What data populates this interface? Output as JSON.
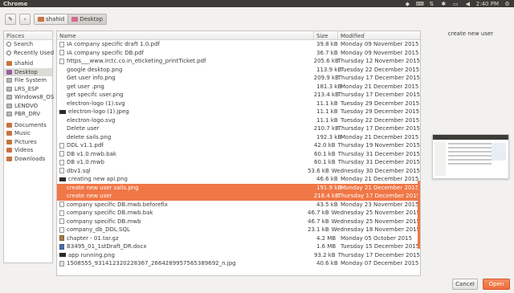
{
  "topbar": {
    "title": "Chrome",
    "time": "2:40 PM",
    "tray_icons": [
      "dropbox-icon",
      "keyboard-icon",
      "network-icon",
      "bluetooth-icon",
      "battery-icon",
      "volume-icon",
      "clock",
      "settings-icon"
    ]
  },
  "toolbar": {
    "edit_glyph": "✎",
    "back_glyph": "‹",
    "crumbs": [
      {
        "label": "shahid",
        "active": false
      },
      {
        "label": "Desktop",
        "active": true
      }
    ]
  },
  "places": {
    "header": "Places",
    "items": [
      {
        "label": "Search",
        "icon": "search-icon",
        "active": false
      },
      {
        "label": "Recently Used",
        "icon": "recent-icon",
        "active": false
      },
      {
        "label": "shahid",
        "icon": "home-folder-icon",
        "active": false
      },
      {
        "label": "Desktop",
        "icon": "desktop-folder-icon",
        "active": true
      },
      {
        "label": "File System",
        "icon": "drive-icon",
        "active": false
      },
      {
        "label": "LRS_ESP",
        "icon": "drive-icon",
        "active": false
      },
      {
        "label": "Windows8_OS",
        "icon": "drive-icon",
        "active": false
      },
      {
        "label": "LENOVO",
        "icon": "drive-icon",
        "active": false
      },
      {
        "label": "PBR_DRV",
        "icon": "drive-icon",
        "active": false
      },
      {
        "label": "Documents",
        "icon": "documents-folder-icon",
        "active": false
      },
      {
        "label": "Music",
        "icon": "music-folder-icon",
        "active": false
      },
      {
        "label": "Pictures",
        "icon": "pictures-folder-icon",
        "active": false
      },
      {
        "label": "Videos",
        "icon": "videos-folder-icon",
        "active": false
      },
      {
        "label": "Downloads",
        "icon": "downloads-folder-icon",
        "active": false
      }
    ]
  },
  "files": {
    "columns": {
      "name": "Name",
      "size": "Size",
      "modified": "Modified"
    },
    "rows": [
      {
        "name": "IA company specific draft 1.0.pdf",
        "size": "39.8 kB",
        "modified": "Monday 09 November 2015",
        "icon": "file",
        "selected": false
      },
      {
        "name": "IA company specific DB.pdf",
        "size": "36.7 kB",
        "modified": "Monday 09 November 2015",
        "icon": "file",
        "selected": false
      },
      {
        "name": "https___www.irctc.co.in_eticketing_printTicket.pdf",
        "size": "205.6 kB",
        "modified": "Thursday 12 November 2015",
        "icon": "file",
        "selected": false
      },
      {
        "name": "google desktop.png",
        "size": "113.9 kB",
        "modified": "Tuesday 22 December 2015",
        "icon": "none",
        "selected": false
      },
      {
        "name": "Get user info.png",
        "size": "209.9 kB",
        "modified": "Thursday 17 December 2015",
        "icon": "none",
        "selected": false
      },
      {
        "name": "get user .png",
        "size": "181.3 kB",
        "modified": "Monday 21 December 2015",
        "icon": "none",
        "selected": false
      },
      {
        "name": "get specifc user.png",
        "size": "213.4 kB",
        "modified": "Thursday 17 December 2015",
        "icon": "none",
        "selected": false
      },
      {
        "name": "electron-logo (1).svg",
        "size": "11.1 kB",
        "modified": "Tuesday 29 December 2015",
        "icon": "none",
        "selected": false
      },
      {
        "name": "electron-logo (1).jpeg",
        "size": "11.1 kB",
        "modified": "Tuesday 29 December 2015",
        "icon": "dark",
        "selected": false
      },
      {
        "name": "electron-logo.svg",
        "size": "11.1 kB",
        "modified": "Tuesday 22 December 2015",
        "icon": "none",
        "selected": false
      },
      {
        "name": "Delete user",
        "size": "210.7 kB",
        "modified": "Thursday 17 December 2015",
        "icon": "none",
        "selected": false
      },
      {
        "name": "delete sails.png",
        "size": "192.3 kB",
        "modified": "Monday 21 December 2015",
        "icon": "none",
        "selected": false
      },
      {
        "name": "DDL v1.1.pdf",
        "size": "42.0 kB",
        "modified": "Thursday 19 November 2015",
        "icon": "file",
        "selected": false
      },
      {
        "name": "DB v1.0.mwb.bak",
        "size": "60.1 kB",
        "modified": "Thursday 31 December 2015",
        "icon": "file",
        "selected": false
      },
      {
        "name": "DB v1.0.mwb",
        "size": "60.1 kB",
        "modified": "Thursday 31 December 2015",
        "icon": "file",
        "selected": false
      },
      {
        "name": "dbv1.sql",
        "size": "53.6 kB",
        "modified": "Wednesday 30 December 2015",
        "icon": "file",
        "selected": false
      },
      {
        "name": "creating new api.png",
        "size": "46.6 kB",
        "modified": "Monday 21 December 2015",
        "icon": "dark",
        "selected": false
      },
      {
        "name": "create new user sails.png",
        "size": "191.9 kB",
        "modified": "Monday 21 December 2015",
        "icon": "none",
        "selected": true
      },
      {
        "name": "create new user",
        "size": "216.4 kB",
        "modified": "Thursday 17 December 2015",
        "icon": "none",
        "selected": true
      },
      {
        "name": "company specific DB.mwb.beforefix",
        "size": "43.5 kB",
        "modified": "Monday 23 November 2015",
        "icon": "file",
        "selected": false
      },
      {
        "name": "company specific DB.mwb.bak",
        "size": "46.7 kB",
        "modified": "Wednesday 25 November 2015",
        "icon": "file",
        "selected": false
      },
      {
        "name": "company specific DB.mwb",
        "size": "46.7 kB",
        "modified": "Wednesday 25 November 2015",
        "icon": "file",
        "selected": false
      },
      {
        "name": "company_db_DDL.SQL",
        "size": "23.1 kB",
        "modified": "Wednesday 18 November 2015",
        "icon": "file",
        "selected": false
      },
      {
        "name": "chapter - 01.tar.gz",
        "size": "4.2 MB",
        "modified": "Monday 05 October 2015",
        "icon": "arch",
        "selected": false
      },
      {
        "name": "B3495_01_1stDraft_DR.docx",
        "size": "1.6 MB",
        "modified": "Tuesday 15 December 2015",
        "icon": "doc",
        "selected": false
      },
      {
        "name": "app running.png",
        "size": "93.2 kB",
        "modified": "Thursday 17 December 2015",
        "icon": "dark",
        "selected": false
      },
      {
        "name": "1508555_931412320228367_2664289957565389692_n.jpg",
        "size": "40.6 kB",
        "modified": "Monday 07 December 2015",
        "icon": "img",
        "selected": false
      }
    ]
  },
  "preview": {
    "label": "create new user"
  },
  "buttons": {
    "cancel": "Cancel",
    "open": "Open"
  },
  "colors": {
    "accent": "#f07746",
    "panel": "#3c3b37"
  }
}
